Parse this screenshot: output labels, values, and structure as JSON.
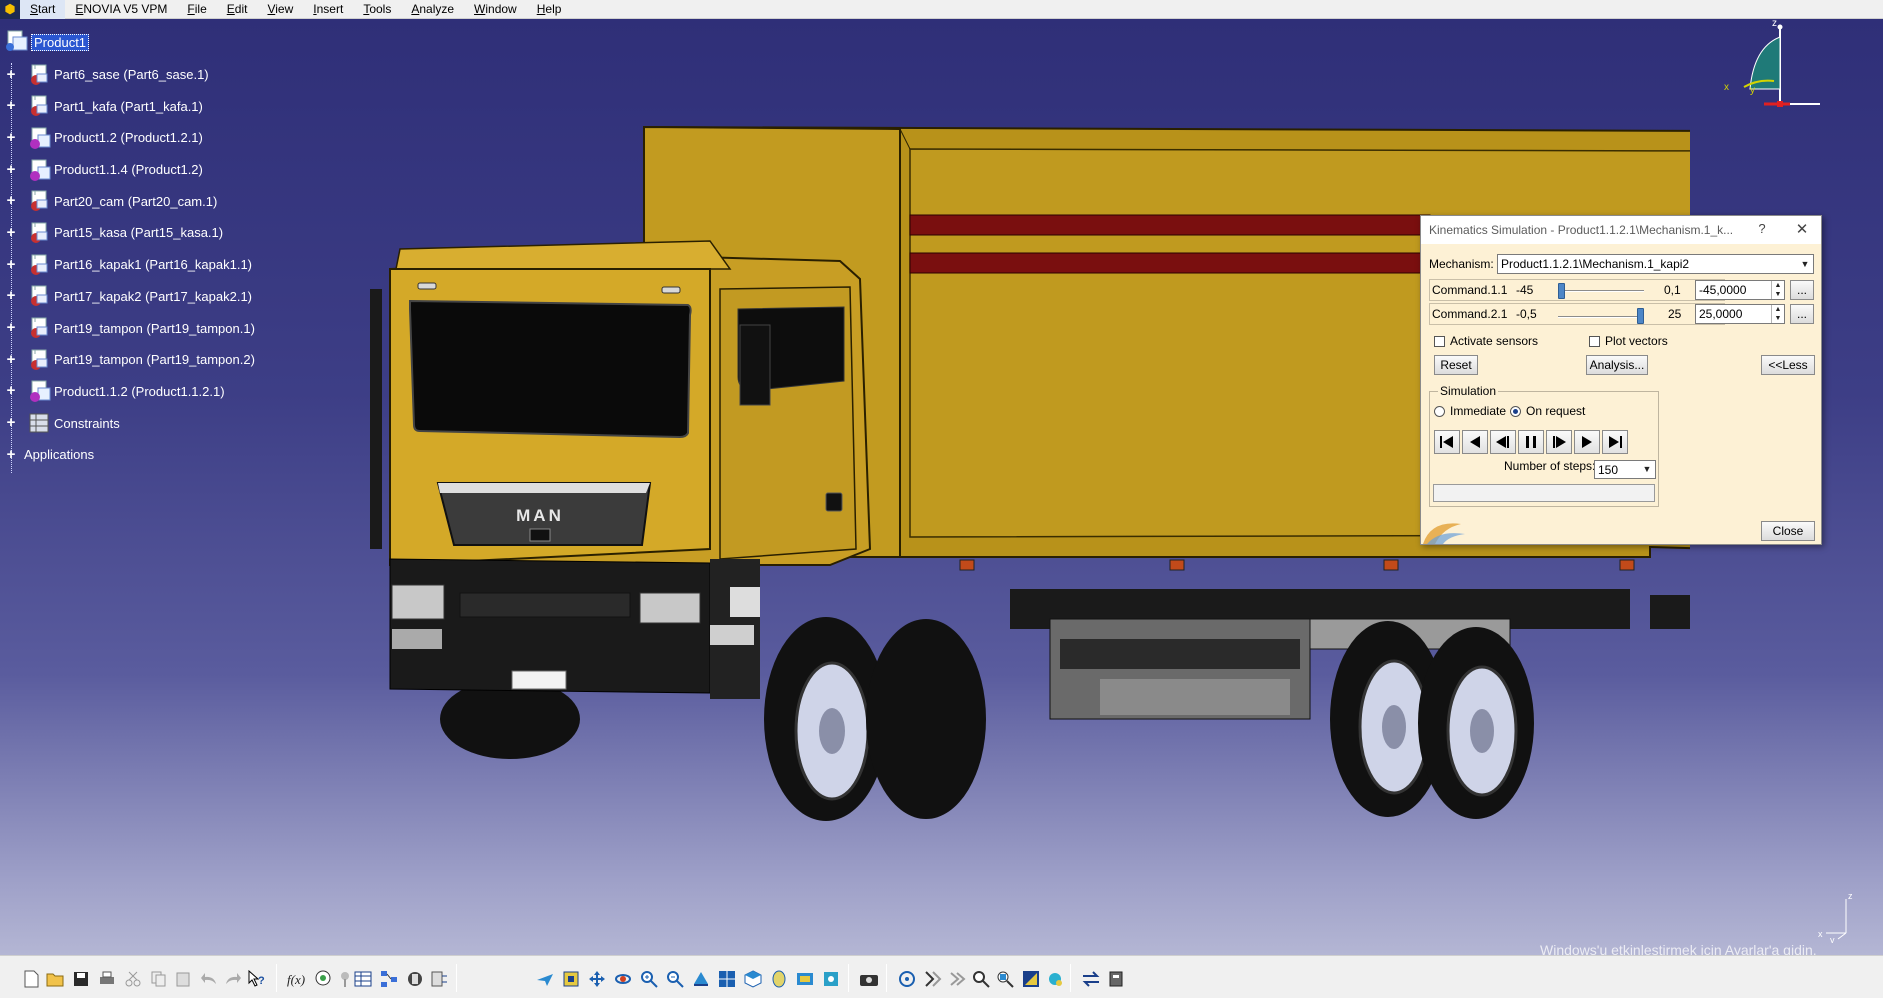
{
  "menubar": {
    "start": "Start",
    "items": [
      "ENOVIA V5 VPM",
      "File",
      "Edit",
      "View",
      "Insert",
      "Tools",
      "Analyze",
      "Window",
      "Help"
    ]
  },
  "tree": {
    "root": "Product1",
    "nodes": [
      {
        "label": "Part6_sase (Part6_sase.1)",
        "icon": "part-icon"
      },
      {
        "label": "Part1_kafa (Part1_kafa.1)",
        "icon": "part-icon"
      },
      {
        "label": "Product1.2 (Product1.2.1)",
        "icon": "product-icon"
      },
      {
        "label": "Product1.1.4 (Product1.2)",
        "icon": "product-icon"
      },
      {
        "label": "Part20_cam (Part20_cam.1)",
        "icon": "part-icon"
      },
      {
        "label": "Part15_kasa (Part15_kasa.1)",
        "icon": "part-icon"
      },
      {
        "label": "Part16_kapak1 (Part16_kapak1.1)",
        "icon": "part-icon"
      },
      {
        "label": "Part17_kapak2 (Part17_kapak2.1)",
        "icon": "part-icon"
      },
      {
        "label": "Part19_tampon (Part19_tampon.1)",
        "icon": "part-icon"
      },
      {
        "label": "Part19_tampon (Part19_tampon.2)",
        "icon": "part-icon"
      },
      {
        "label": "Product1.1.2 (Product1.1.2.1)",
        "icon": "product-icon"
      },
      {
        "label": "Constraints",
        "icon": "constraints-icon"
      }
    ],
    "applications": "Applications"
  },
  "compass": {
    "x": "x",
    "y": "y",
    "z": "z"
  },
  "truck": {
    "brand": "MAN"
  },
  "dialog": {
    "title": "Kinematics Simulation - Product1.1.2.1\\Mechanism.1_k...",
    "help": "?",
    "close_x": "✕",
    "mechanism_label": "Mechanism:",
    "mechanism_value": "Product1.1.2.1\\Mechanism.1_kapi2",
    "commands": [
      {
        "label": "Command.1.1",
        "min": "-45",
        "max": "0,1",
        "value": "-45,0000",
        "slider_fraction": 0.0
      },
      {
        "label": "Command.2.1",
        "min": "-0,5",
        "max": "25",
        "value": "25,0000",
        "slider_fraction": 1.0
      }
    ],
    "dots": "...",
    "activate_sensors": "Activate sensors",
    "plot_vectors": "Plot vectors",
    "reset": "Reset",
    "analysis": "Analysis...",
    "less": "<<Less",
    "simulation_label": "Simulation",
    "immediate": "Immediate",
    "on_request": "On request",
    "steps_label": "Number of steps:",
    "steps_value": "150",
    "close": "Close"
  },
  "watermark": {
    "line1": "Windows'u etkinleştirmek için Ayarlar'a gidin."
  },
  "colors": {
    "truck_yellow": "#c8a21e",
    "cab_yellow": "#d4a928",
    "dialog_bg": "#fdf1d5",
    "tree_selection": "#2a56d0"
  }
}
